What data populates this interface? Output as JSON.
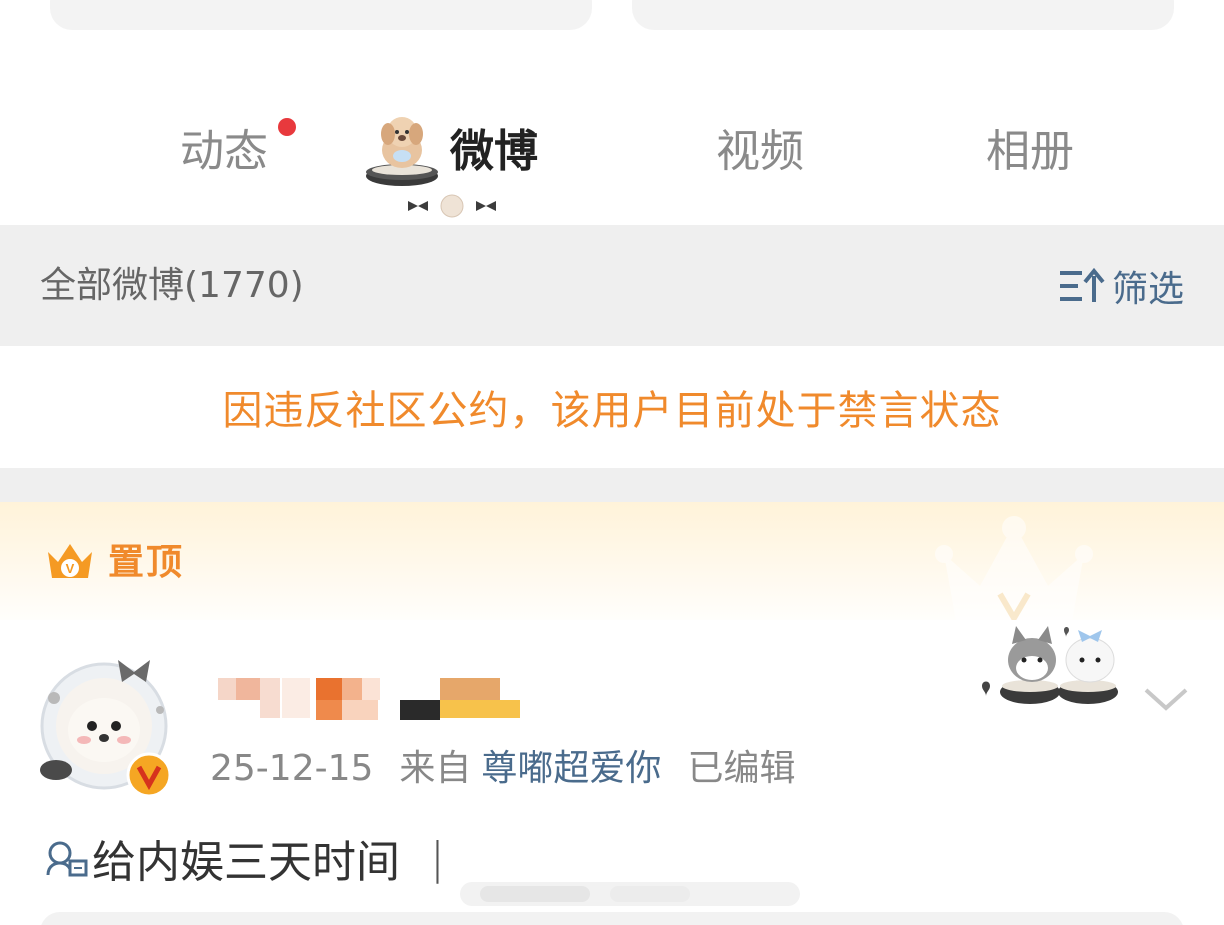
{
  "tabs": [
    {
      "label": "动态",
      "has_dot": true
    },
    {
      "label": "微博",
      "active": true
    },
    {
      "label": "视频"
    },
    {
      "label": "相册"
    }
  ],
  "filter_bar": {
    "count_label": "全部微博(1770)",
    "filter_label": "筛选"
  },
  "notice": {
    "text": "因违反社区公约，该用户目前处于禁言状态"
  },
  "pinned": {
    "label": "置顶",
    "badge_letter": "V"
  },
  "post": {
    "date": "25-12-15",
    "source_prefix": "来自",
    "source": "尊嘟超爱你",
    "edited": "已编辑",
    "text": "给内娱三天时间",
    "cursor": "|"
  },
  "colors": {
    "accent_orange": "#f08a2c",
    "link_blue": "#4a6b8c",
    "notification_red": "#e8393d",
    "bar_gray": "#efefef"
  },
  "icons": {
    "filter": "filter-sort-icon",
    "pinned_crown": "crown-icon",
    "chevron": "chevron-down-icon",
    "verified": "verified-badge-icon",
    "super_topic": "super-topic-icon"
  }
}
